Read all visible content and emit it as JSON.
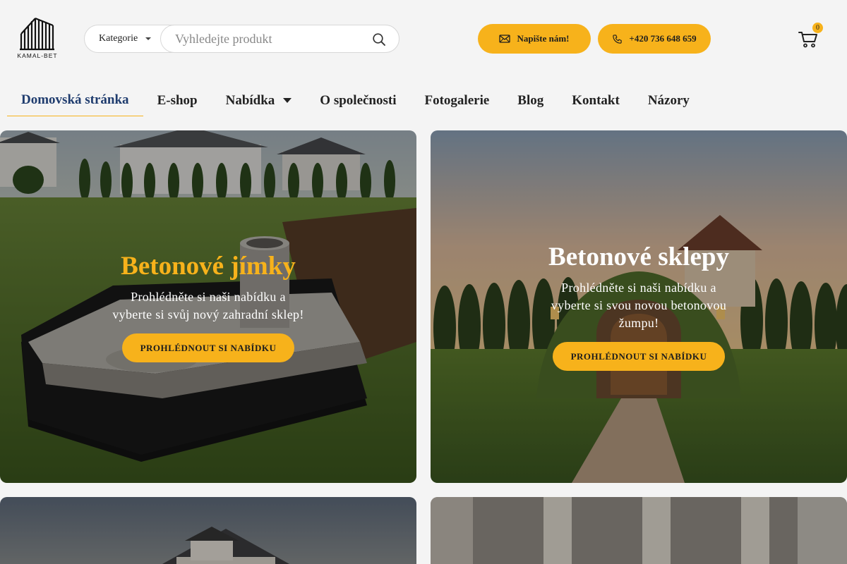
{
  "brand": {
    "logo_text": "KAMAL-BET",
    "accent": "#f7b21b",
    "nav_active_color": "#1f3c6e"
  },
  "search": {
    "category_label": "Kategorie",
    "placeholder": "Vyhledejte produkt"
  },
  "contact": {
    "email_label": "Napište nám!",
    "phone_label": "+420 736 648 659"
  },
  "cart": {
    "count": "0"
  },
  "nav": {
    "items": [
      {
        "label": "Domovská stránka",
        "active": true
      },
      {
        "label": "E-shop"
      },
      {
        "label": "Nabídka",
        "has_dropdown": true
      },
      {
        "label": "O společnosti"
      },
      {
        "label": "Fotogalerie"
      },
      {
        "label": "Blog"
      },
      {
        "label": "Kontakt"
      },
      {
        "label": "Názory"
      }
    ]
  },
  "cards": [
    {
      "title": "Betonové jímky",
      "title_color": "#f7b21b",
      "desc_line1": "Prohlédněte si naši nabídku a",
      "desc_line2": "vyberte si svůj nový zahradní sklep!",
      "button": "PROHLÉDNOUT SI NABÍDKU"
    },
    {
      "title": "Betonové sklepy",
      "title_color": "#ffffff",
      "desc_line1": "Prohlédněte si naši nabídku a",
      "desc_line2": "vyberte si svou novou betonovou",
      "desc_line3": "žumpu!",
      "button": "PROHLÉDNOUT SI NABÍDKU"
    }
  ]
}
